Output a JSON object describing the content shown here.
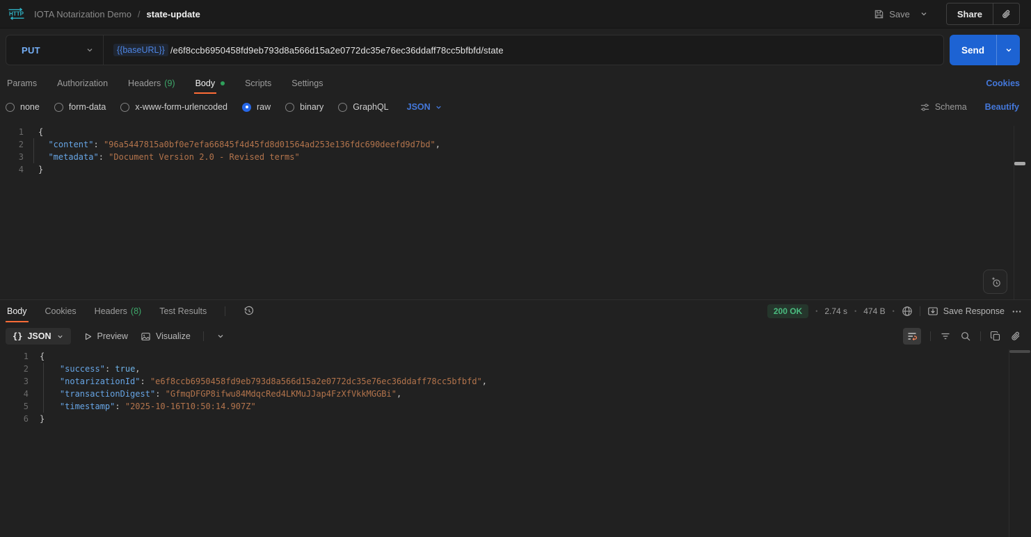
{
  "colors": {
    "accent_orange": "#FF6C37",
    "accent_blue": "#4478DB",
    "method_color": "#74AEF6",
    "send_button": "#1D63D3",
    "count_green": "#3FA86B",
    "status_green": "#4ABB7F",
    "code_key": "#67A5E5",
    "code_string": "#B3744C",
    "icon_teal": "#2FB4C7"
  },
  "header": {
    "collection_name": "IOTA Notarization Demo",
    "separator": "/",
    "request_name": "state-update",
    "save_label": "Save",
    "share_label": "Share"
  },
  "request_bar": {
    "method": "PUT",
    "base_url_variable": "{{baseURL}}",
    "path": "/e6f8ccb6950458fd9eb793d8a566d15a2e0772dc35e76ec36ddaff78cc5bfbfd/state",
    "send_label": "Send"
  },
  "request_tabs": {
    "params": "Params",
    "authorization": "Authorization",
    "headers": "Headers",
    "headers_count": "(9)",
    "body": "Body",
    "scripts": "Scripts",
    "settings": "Settings",
    "cookies_link": "Cookies"
  },
  "body_options": {
    "modes": [
      "none",
      "form-data",
      "x-www-form-urlencoded",
      "raw",
      "binary",
      "GraphQL"
    ],
    "selected_mode": "raw",
    "language": "JSON",
    "schema_label": "Schema",
    "beautify_label": "Beautify"
  },
  "request_editor": {
    "lines": [
      [
        [
          "p",
          "{"
        ]
      ],
      [
        [
          "w",
          "  "
        ],
        [
          "k",
          "\"content\""
        ],
        [
          "p",
          ": "
        ],
        [
          "s",
          "\"96a5447815a0bf0e7efa66845f4d45fd8d01564ad253e136fdc690deefd9d7bd\""
        ],
        [
          "p",
          ","
        ]
      ],
      [
        [
          "w",
          "  "
        ],
        [
          "k",
          "\"metadata\""
        ],
        [
          "p",
          ": "
        ],
        [
          "s",
          "\"Document Version 2.0 - Revised terms\""
        ]
      ],
      [
        [
          "p",
          "}"
        ]
      ]
    ]
  },
  "response_tabs": {
    "body": "Body",
    "cookies": "Cookies",
    "headers": "Headers",
    "headers_count": "(8)",
    "test_results": "Test Results"
  },
  "response_meta": {
    "status": "200 OK",
    "dot": "•",
    "time": "2.74 s",
    "size": "474 B",
    "save_response_label": "Save Response"
  },
  "response_toolbar": {
    "format_icon": "{}",
    "format_label": "JSON",
    "preview_label": "Preview",
    "visualize_label": "Visualize"
  },
  "response_editor": {
    "lines": [
      [
        [
          "p",
          "{"
        ]
      ],
      [
        [
          "w",
          "    "
        ],
        [
          "k",
          "\"success\""
        ],
        [
          "p",
          ": "
        ],
        [
          "b",
          "true"
        ],
        [
          "p",
          ","
        ]
      ],
      [
        [
          "w",
          "    "
        ],
        [
          "k",
          "\"notarizationId\""
        ],
        [
          "p",
          ": "
        ],
        [
          "s",
          "\"e6f8ccb6950458fd9eb793d8a566d15a2e0772dc35e76ec36ddaff78cc5bfbfd\""
        ],
        [
          "p",
          ","
        ]
      ],
      [
        [
          "w",
          "    "
        ],
        [
          "k",
          "\"transactionDigest\""
        ],
        [
          "p",
          ": "
        ],
        [
          "s",
          "\"GfmqDFGP8ifwu84MdqcRed4LKMuJJap4FzXfVkkMGGBi\""
        ],
        [
          "p",
          ","
        ]
      ],
      [
        [
          "w",
          "    "
        ],
        [
          "k",
          "\"timestamp\""
        ],
        [
          "p",
          ": "
        ],
        [
          "s",
          "\"2025-10-16T10:50:14.907Z\""
        ]
      ],
      [
        [
          "p",
          "}"
        ]
      ]
    ]
  }
}
